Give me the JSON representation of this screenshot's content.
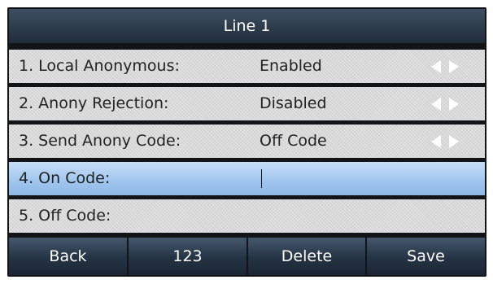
{
  "title": "Line 1",
  "rows": [
    {
      "label": "1. Local Anonymous:",
      "value": "Enabled",
      "has_arrows": true
    },
    {
      "label": "2. Anony Rejection:",
      "value": "Disabled",
      "has_arrows": true
    },
    {
      "label": "3. Send Anony Code:",
      "value": "Off Code",
      "has_arrows": true
    },
    {
      "label": "4. On Code:",
      "value": "",
      "has_arrows": false,
      "selected": true
    },
    {
      "label": "5. Off Code:",
      "value": "",
      "has_arrows": false
    }
  ],
  "softkeys": [
    "Back",
    "123",
    "Delete",
    "Save"
  ],
  "icons": {
    "left_arrow": "triangle-left-icon",
    "right_arrow": "triangle-right-icon"
  },
  "colors": {
    "title_bar": "#2d3c4d",
    "row_background": "#d9d9d9",
    "selected_row": "#a8ccf0",
    "softkey": "#2a3a4b",
    "arrow": "#ffffff"
  }
}
